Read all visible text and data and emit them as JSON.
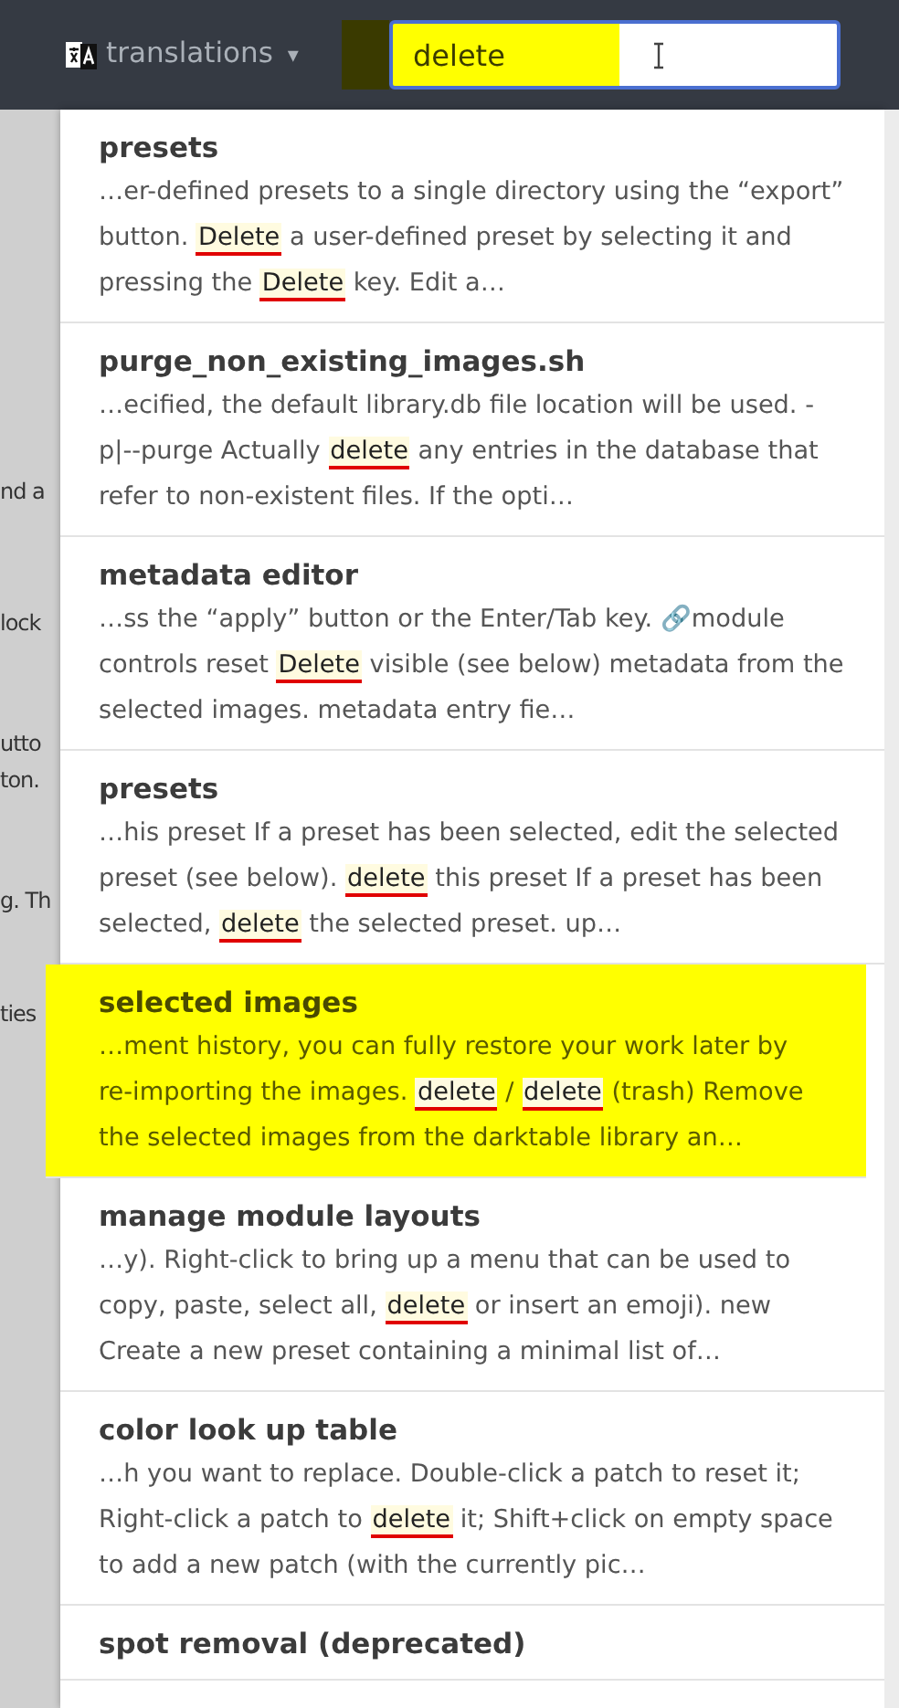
{
  "header": {
    "menu": {
      "label": "translations",
      "caret": "▾"
    },
    "search": {
      "value": "delete",
      "highlighted": true
    }
  },
  "background_text": [
    "nd a",
    "lock",
    "utto",
    "ton.",
    "g. Th",
    "ties"
  ],
  "results": [
    {
      "title": "presets",
      "selected": false,
      "snippet": [
        {
          "text": "…er-defined presets to a single directory using the “export” button. ",
          "match": false
        },
        {
          "text": "Delete",
          "match": true
        },
        {
          "text": " a user-defined preset by selecting it and pressing the ",
          "match": false
        },
        {
          "text": "Delete",
          "match": true
        },
        {
          "text": " key. Edit a…",
          "match": false
        }
      ]
    },
    {
      "title": "purge_non_existing_images.sh",
      "selected": false,
      "snippet": [
        {
          "text": "…ecified, the default library.db file location will be used. -p|--purge Actually ",
          "match": false
        },
        {
          "text": "delete",
          "match": true
        },
        {
          "text": " any entries in the database that refer to non-existent files. If the opti…",
          "match": false
        }
      ]
    },
    {
      "title": "metadata editor",
      "selected": false,
      "snippet": [
        {
          "text": "…ss the “apply” button or the Enter/Tab key. 🔗module controls reset ",
          "match": false
        },
        {
          "text": "Delete",
          "match": true
        },
        {
          "text": " visible (see below) metadata from the selected images. metadata entry fie…",
          "match": false
        }
      ]
    },
    {
      "title": "presets",
      "selected": false,
      "snippet": [
        {
          "text": "…his preset If a preset has been selected, edit the selected preset (see below). ",
          "match": false
        },
        {
          "text": "delete",
          "match": true
        },
        {
          "text": " this preset If a preset has been selected, ",
          "match": false
        },
        {
          "text": "delete",
          "match": true
        },
        {
          "text": " the selected preset. up…",
          "match": false
        }
      ]
    },
    {
      "title": "selected images",
      "selected": true,
      "snippet": [
        {
          "text": "…ment history, you can fully restore your work later by re-importing the images. ",
          "match": false
        },
        {
          "text": "delete",
          "match": true
        },
        {
          "text": " / ",
          "match": false
        },
        {
          "text": "delete",
          "match": true
        },
        {
          "text": " (trash) Remove the selected images from the darktable library an…",
          "match": false
        }
      ]
    },
    {
      "title": "manage module layouts",
      "selected": false,
      "snippet": [
        {
          "text": "…y). Right-click to bring up a menu that can be used to copy, paste, select all, ",
          "match": false
        },
        {
          "text": "delete",
          "match": true
        },
        {
          "text": " or insert an emoji). new Create a new preset containing a minimal list of…",
          "match": false
        }
      ]
    },
    {
      "title": "color look up table",
      "selected": false,
      "snippet": [
        {
          "text": "…h you want to replace. Double-click a patch to reset it; Right-click a patch to ",
          "match": false
        },
        {
          "text": "delete",
          "match": true
        },
        {
          "text": " it; Shift+click on empty space to add a new patch (with the currently pic…",
          "match": false
        }
      ]
    },
    {
      "title": "spot removal (deprecated)",
      "selected": false
    }
  ]
}
